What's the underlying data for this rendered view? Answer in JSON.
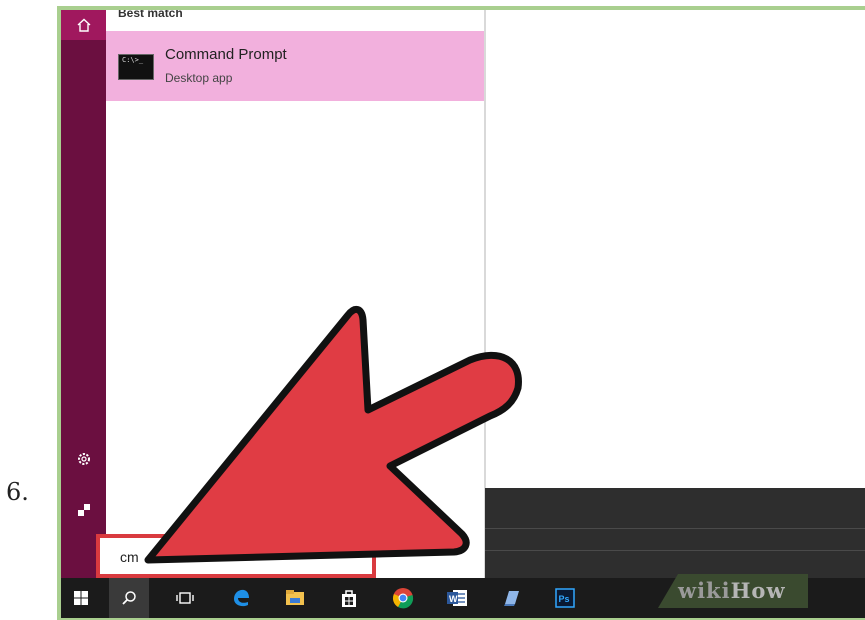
{
  "step": {
    "number": "6."
  },
  "start_menu": {
    "section_title": "Best match",
    "result": {
      "title": "Command Prompt",
      "subtitle": "Desktop app",
      "icon_text": "C:\\>_"
    },
    "search": {
      "value": "cm"
    },
    "rail_icons": [
      "home-icon",
      "settings-icon",
      "user-icon"
    ]
  },
  "taskbar": {
    "items": [
      "windows-start-icon",
      "search-icon",
      "task-view-icon",
      "edge-icon",
      "file-explorer-icon",
      "store-icon",
      "chrome-icon",
      "word-icon",
      "notes-icon",
      "photoshop-icon"
    ]
  },
  "watermark": {
    "part1": "wiki",
    "part2": "How"
  },
  "colors": {
    "rail": "#6b0f40",
    "highlight": "#f2b0dd",
    "arrow": "#e03c44",
    "frame": "#a9cf8f",
    "taskbar": "#1b1b1b"
  }
}
